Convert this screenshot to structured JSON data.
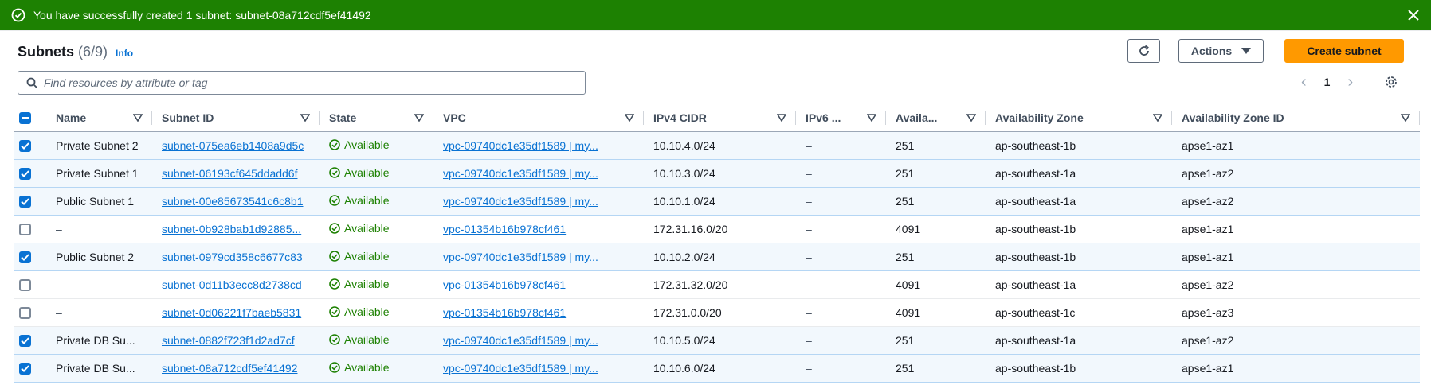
{
  "flash": {
    "message": "You have successfully created 1 subnet: subnet-08a712cdf5ef41492"
  },
  "header": {
    "title": "Subnets",
    "count": "(6/9)",
    "info": "Info"
  },
  "toolbar": {
    "actions_label": "Actions",
    "create_label": "Create subnet"
  },
  "search": {
    "placeholder": "Find resources by attribute or tag",
    "value": ""
  },
  "pagination": {
    "page": "1"
  },
  "colors": {
    "success": "#1d8102",
    "primary": "#ff9900",
    "link": "#0972d3"
  },
  "table": {
    "columns": [
      "Name",
      "Subnet ID",
      "State",
      "VPC",
      "IPv4 CIDR",
      "IPv6 ...",
      "Availa...",
      "Availability Zone",
      "Availability Zone ID"
    ],
    "rows": [
      {
        "selected": true,
        "name": "Private Subnet 2",
        "subnet_id": "subnet-075ea6eb1408a9d5c",
        "state": "Available",
        "vpc": "vpc-09740dc1e35df1589 | my...",
        "ipv4": "10.10.4.0/24",
        "ipv6": "–",
        "available": "251",
        "az": "ap-southeast-1b",
        "az_id": "apse1-az1"
      },
      {
        "selected": true,
        "name": "Private Subnet 1",
        "subnet_id": "subnet-06193cf645ddadd6f",
        "state": "Available",
        "vpc": "vpc-09740dc1e35df1589 | my...",
        "ipv4": "10.10.3.0/24",
        "ipv6": "–",
        "available": "251",
        "az": "ap-southeast-1a",
        "az_id": "apse1-az2"
      },
      {
        "selected": true,
        "name": "Public Subnet 1",
        "subnet_id": "subnet-00e85673541c6c8b1",
        "state": "Available",
        "vpc": "vpc-09740dc1e35df1589 | my...",
        "ipv4": "10.10.1.0/24",
        "ipv6": "–",
        "available": "251",
        "az": "ap-southeast-1a",
        "az_id": "apse1-az2"
      },
      {
        "selected": false,
        "name": "–",
        "subnet_id": "subnet-0b928bab1d92885...",
        "state": "Available",
        "vpc": "vpc-01354b16b978cf461",
        "ipv4": "172.31.16.0/20",
        "ipv6": "–",
        "available": "4091",
        "az": "ap-southeast-1b",
        "az_id": "apse1-az1"
      },
      {
        "selected": true,
        "name": "Public Subnet 2",
        "subnet_id": "subnet-0979cd358c6677c83",
        "state": "Available",
        "vpc": "vpc-09740dc1e35df1589 | my...",
        "ipv4": "10.10.2.0/24",
        "ipv6": "–",
        "available": "251",
        "az": "ap-southeast-1b",
        "az_id": "apse1-az1"
      },
      {
        "selected": false,
        "name": "–",
        "subnet_id": "subnet-0d11b3ecc8d2738cd",
        "state": "Available",
        "vpc": "vpc-01354b16b978cf461",
        "ipv4": "172.31.32.0/20",
        "ipv6": "–",
        "available": "4091",
        "az": "ap-southeast-1a",
        "az_id": "apse1-az2"
      },
      {
        "selected": false,
        "name": "–",
        "subnet_id": "subnet-0d06221f7baeb5831",
        "state": "Available",
        "vpc": "vpc-01354b16b978cf461",
        "ipv4": "172.31.0.0/20",
        "ipv6": "–",
        "available": "4091",
        "az": "ap-southeast-1c",
        "az_id": "apse1-az3"
      },
      {
        "selected": true,
        "name": "Private DB Su...",
        "subnet_id": "subnet-0882f723f1d2ad7cf",
        "state": "Available",
        "vpc": "vpc-09740dc1e35df1589 | my...",
        "ipv4": "10.10.5.0/24",
        "ipv6": "–",
        "available": "251",
        "az": "ap-southeast-1a",
        "az_id": "apse1-az2"
      },
      {
        "selected": true,
        "name": "Private DB Su...",
        "subnet_id": "subnet-08a712cdf5ef41492",
        "state": "Available",
        "vpc": "vpc-09740dc1e35df1589 | my...",
        "ipv4": "10.10.6.0/24",
        "ipv6": "–",
        "available": "251",
        "az": "ap-southeast-1b",
        "az_id": "apse1-az1"
      }
    ]
  }
}
